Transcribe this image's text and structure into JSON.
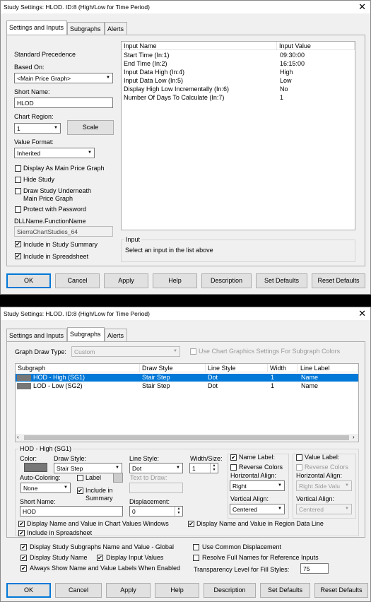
{
  "dialog1": {
    "title": "Study Settings: HLOD. ID:8 (High/Low for Time Period)",
    "close": "✕",
    "tabs": [
      "Settings and Inputs",
      "Subgraphs",
      "Alerts"
    ],
    "standard_precedence": "Standard Precedence",
    "based_on_label": "Based On:",
    "based_on_value": "<Main Price Graph>",
    "short_name_label": "Short Name:",
    "short_name_value": "HLOD",
    "chart_region_label": "Chart Region:",
    "chart_region_value": "1",
    "scale_button": "Scale",
    "value_format_label": "Value Format:",
    "value_format_value": "Inherited",
    "cb_display_main": "Display As Main Price Graph",
    "cb_hide": "Hide Study",
    "cb_draw_under_1": "Draw Study Underneath",
    "cb_draw_under_2": "Main Price Graph",
    "cb_protect": "Protect with Password",
    "dll_label": "DLLName.FunctionName",
    "dll_value": "SierraChartStudies_64",
    "cb_summary": "Include in Study Summary",
    "cb_spreadsheet": "Include in Spreadsheet",
    "inputs_header": [
      "Input Name",
      "Input Value"
    ],
    "inputs": [
      {
        "name": "Start Time  (In:1)",
        "value": "09:30:00"
      },
      {
        "name": "End Time  (In:2)",
        "value": "16:15:00"
      },
      {
        "name": "Input Data High  (In:4)",
        "value": "High"
      },
      {
        "name": "Input Data Low  (In:5)",
        "value": "Low"
      },
      {
        "name": "Display High Low Incrementally  (In:6)",
        "value": "No"
      },
      {
        "name": "Number Of Days To Calculate  (In:7)",
        "value": "1"
      }
    ],
    "input_group_title": "Input",
    "input_group_text": "Select an input in the list above",
    "buttons": [
      "OK",
      "Cancel",
      "Apply",
      "Help",
      "Description",
      "Set Defaults",
      "Reset Defaults"
    ]
  },
  "dialog2": {
    "title": "Study Settings: HLOD. ID:8 (High/Low for Time Period)",
    "close": "✕",
    "tabs": [
      "Settings and Inputs",
      "Subgraphs",
      "Alerts"
    ],
    "graph_draw_type_label": "Graph Draw Type:",
    "graph_draw_type_value": "Custom",
    "use_chart_graphics": "Use Chart Graphics Settings For Subgraph Colors",
    "subgraph_header": [
      "Subgraph",
      "Draw Style",
      "Line Style",
      "Width",
      "Line Label"
    ],
    "subgraphs": [
      {
        "name": "HOD - High (SG1)",
        "draw": "Stair Step",
        "line": "Dot",
        "width": "1",
        "label": "Name",
        "color": "#777777"
      },
      {
        "name": "LOD - Low (SG2)",
        "draw": "Stair Step",
        "line": "Dot",
        "width": "1",
        "label": "Name",
        "color": "#777777"
      }
    ],
    "selection_color": "#0078d7",
    "group_title": "HOD - High (SG1)",
    "color_label": "Color:",
    "draw_style_label": "Draw Style:",
    "draw_style_value": "Stair Step",
    "line_style_label": "Line Style:",
    "line_style_value": "Dot",
    "width_size_label": "Width/Size:",
    "width_size_value": "1",
    "auto_coloring_label": "Auto-Coloring:",
    "auto_coloring_value": "None",
    "label_cb": "Label",
    "text_to_draw_label": "Text to Draw:",
    "include_summary_1": "Include in",
    "include_summary_2": "Summary",
    "short_name_label": "Short Name:",
    "short_name_value": "HOD",
    "displacement_label": "Displacement:",
    "displacement_value": "0",
    "name_label_cb": "Name Label:",
    "reverse_colors": "Reverse Colors",
    "h_align_label": "Horizontal Align:",
    "h_align_value": "Right",
    "v_align_label": "Vertical Align:",
    "v_align_value": "Centered",
    "value_label_cb": "Value Label:",
    "reverse_colors_2": "Reverse Colors",
    "h_align_label_2": "Horizontal Align:",
    "h_align_value_2": "Right Side Valu",
    "v_align_label_2": "Vertical Align:",
    "v_align_value_2": "Centered",
    "cb_chart_values": "Display Name and Value in Chart Values Windows",
    "cb_region_data": "Display Name and Value in Region Data Line",
    "cb_spreadsheet": "Include in Spreadsheet",
    "cb_global": "Display Study Subgraphs Name and Value - Global",
    "cb_common_disp": "Use Common Displacement",
    "cb_study_name": "Display Study Name",
    "cb_input_values": "Display Input Values",
    "cb_resolve": "Resolve Full Names for Reference Inputs",
    "cb_always_show": "Always Show Name and Value Labels When Enabled",
    "transparency_label": "Transparency Level for Fill Styles:",
    "transparency_value": "75",
    "buttons": [
      "OK",
      "Cancel",
      "Apply",
      "Help",
      "Description",
      "Set Defaults",
      "Reset Defaults"
    ]
  }
}
